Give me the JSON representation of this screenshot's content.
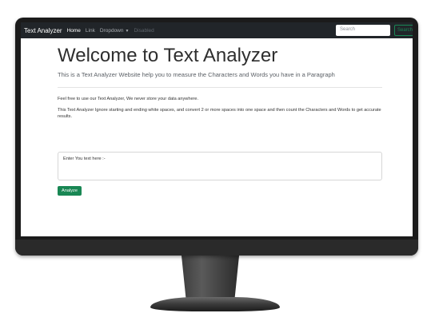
{
  "navbar": {
    "brand": "Text Analyzer",
    "links": [
      "Home",
      "Link",
      "Dropdown",
      "Disabled"
    ],
    "search_placeholder": "Search",
    "search_button": "Search"
  },
  "page": {
    "title": "Welcome to Text Analyzer",
    "lead": "This is a Text Analyzer Website help you to measure the Characters and Words you have in a Paragraph",
    "paragraph1": "Feel free to use our Text Analyzer, We never store your data anywhere.",
    "paragraph2": "This Text Analyzer Ignore starting and ending white spaces, and convert 2 or more spaces into one space and then count the Characters and Words to get accurate results.",
    "textarea_placeholder": "Enter You text here :-",
    "analyze_button": "Analyze"
  },
  "colors": {
    "navbar_bg": "#212529",
    "accent_green": "#198754"
  },
  "icons": {
    "dropdown": "chevron-down-icon"
  }
}
